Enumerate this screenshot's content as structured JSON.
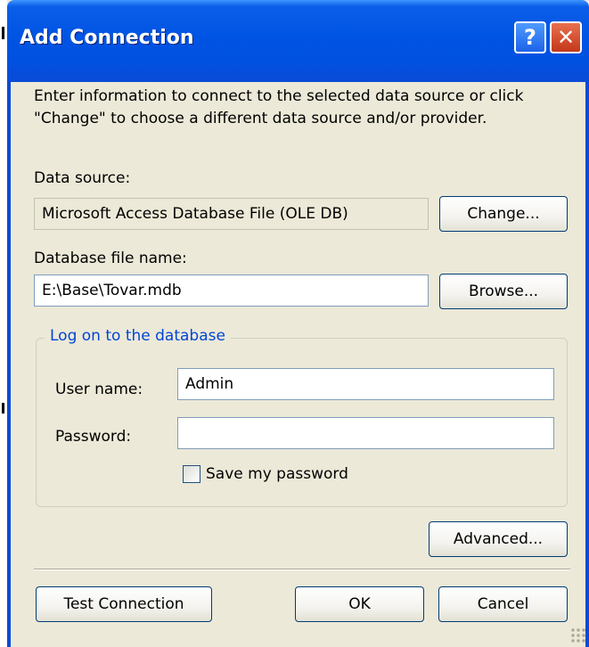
{
  "window": {
    "title": "Add Connection",
    "help_glyph": "?",
    "close_glyph": "✕"
  },
  "intro_text": "Enter information to connect to the selected data source or click \"Change\" to choose a different data source and/or provider.",
  "data_source": {
    "label": "Data source:",
    "value": "Microsoft Access Database File (OLE DB)",
    "change_button": "Change..."
  },
  "database_file": {
    "label": "Database file name:",
    "value": "E:\\Base\\Tovar.mdb",
    "browse_button": "Browse..."
  },
  "logon": {
    "group_title": "Log on to the database",
    "user_label": "User name:",
    "user_value": "Admin",
    "password_label": "Password:",
    "password_value": "",
    "save_password_label": "Save my password",
    "save_password_checked": false
  },
  "advanced_button": "Advanced...",
  "footer": {
    "test_button": "Test Connection",
    "ok_button": "OK",
    "cancel_button": "Cancel"
  },
  "colors": {
    "title_bar": "#0054e3",
    "dialog_bg": "#ece9d8",
    "group_title": "#0046d5",
    "button_border": "#003c74"
  }
}
